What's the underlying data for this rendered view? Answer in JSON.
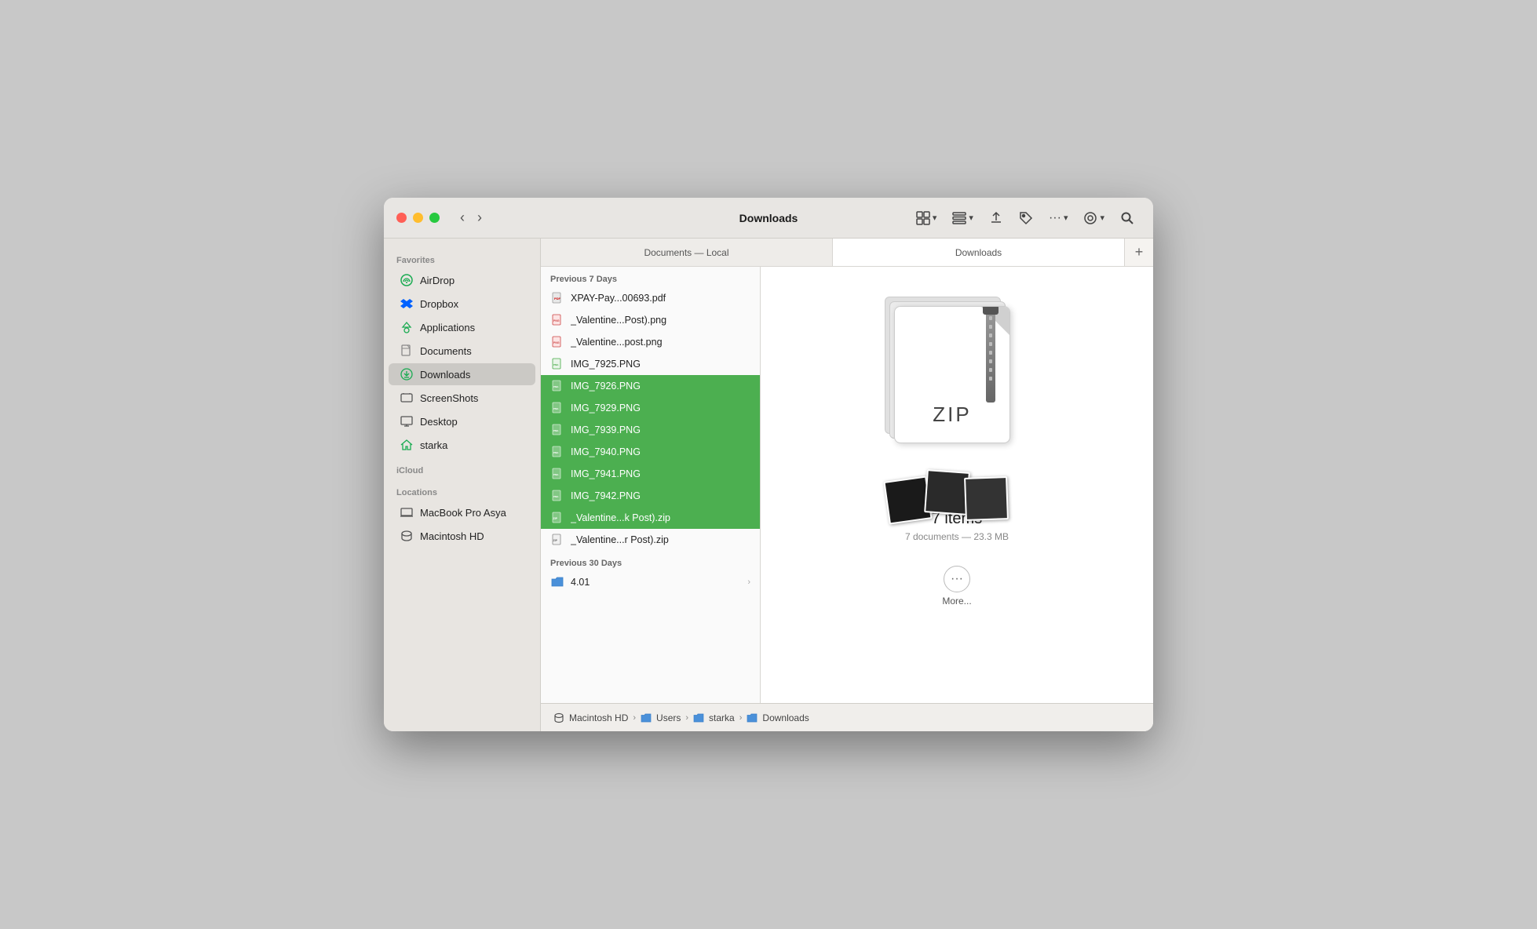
{
  "window": {
    "title": "Downloads"
  },
  "toolbar": {
    "back_label": "‹",
    "forward_label": "›",
    "view_toggle": "⊞",
    "share": "↑",
    "tag": "🏷",
    "more": "···",
    "eye": "👁",
    "search": "🔍"
  },
  "sidebar": {
    "favorites_label": "Favorites",
    "icloud_label": "iCloud",
    "locations_label": "Locations",
    "items": [
      {
        "id": "airdrop",
        "label": "AirDrop",
        "icon": "airdrop"
      },
      {
        "id": "dropbox",
        "label": "Dropbox",
        "icon": "dropbox"
      },
      {
        "id": "applications",
        "label": "Applications",
        "icon": "applications"
      },
      {
        "id": "documents",
        "label": "Documents",
        "icon": "documents"
      },
      {
        "id": "downloads",
        "label": "Downloads",
        "icon": "downloads",
        "active": true
      },
      {
        "id": "screenshots",
        "label": "ScreenShots",
        "icon": "screenshots"
      },
      {
        "id": "desktop",
        "label": "Desktop",
        "icon": "desktop"
      },
      {
        "id": "starka",
        "label": "starka",
        "icon": "home"
      }
    ],
    "locations": [
      {
        "id": "macbook",
        "label": "MacBook Pro Asya",
        "icon": "laptop"
      },
      {
        "id": "macintosh",
        "label": "Macintosh HD",
        "icon": "disk"
      }
    ]
  },
  "tabs": [
    {
      "id": "documents",
      "label": "Documents — Local",
      "active": false
    },
    {
      "id": "downloads",
      "label": "Downloads",
      "active": true
    }
  ],
  "file_list": {
    "section_7days": "Previous 7 Days",
    "section_30days": "Previous 30 Days",
    "files_7days": [
      {
        "name": "XPAY-Pay...00693.pdf",
        "icon": "pdf",
        "selected": false
      },
      {
        "name": "_Valentine...Post).png",
        "icon": "img-red",
        "selected": false
      },
      {
        "name": "_Valentine...post.png",
        "icon": "img-red",
        "selected": false
      },
      {
        "name": "IMG_7925.PNG",
        "icon": "img-phone",
        "selected": false
      },
      {
        "name": "IMG_7926.PNG",
        "icon": "img-phone",
        "selected": true
      },
      {
        "name": "IMG_7929.PNG",
        "icon": "img-phone",
        "selected": true
      },
      {
        "name": "IMG_7939.PNG",
        "icon": "img-phone",
        "selected": true
      },
      {
        "name": "IMG_7940.PNG",
        "icon": "img-phone",
        "selected": true
      },
      {
        "name": "IMG_7941.PNG",
        "icon": "img-phone",
        "selected": true
      },
      {
        "name": "IMG_7942.PNG",
        "icon": "img-phone",
        "selected": true
      },
      {
        "name": "_Valentine...k Post).zip",
        "icon": "zip",
        "selected": true
      },
      {
        "name": "_Valentine...r Post).zip",
        "icon": "zip",
        "selected": false
      }
    ],
    "files_30days": [
      {
        "name": "4.01",
        "icon": "folder",
        "selected": false,
        "has_arrow": true
      }
    ]
  },
  "preview": {
    "item_count": "7 items",
    "item_size": "7 documents — 23.3 MB",
    "more_label": "More..."
  },
  "breadcrumb": [
    {
      "label": "Macintosh HD",
      "icon": "disk"
    },
    {
      "label": "Users",
      "icon": "folder"
    },
    {
      "label": "starka",
      "icon": "folder"
    },
    {
      "label": "Downloads",
      "icon": "downloads"
    }
  ]
}
